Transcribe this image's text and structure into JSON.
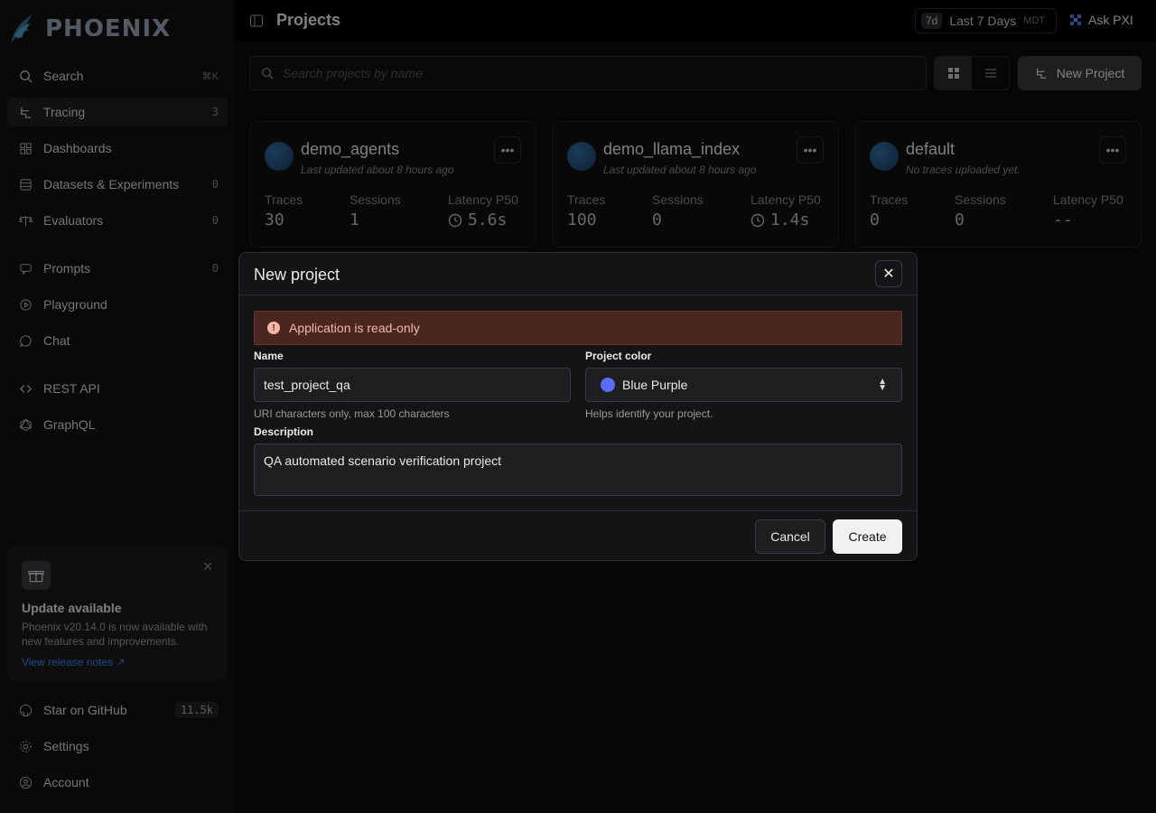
{
  "brand": {
    "name": "PHOENIX"
  },
  "sidebar": {
    "items": [
      {
        "label": "Search",
        "shortcut": "⌘K"
      },
      {
        "label": "Tracing",
        "count": "3"
      },
      {
        "label": "Dashboards"
      },
      {
        "label": "Datasets & Experiments",
        "count": "0"
      },
      {
        "label": "Evaluators",
        "count": "0"
      },
      {
        "label": "Prompts",
        "count": "0"
      },
      {
        "label": "Playground"
      },
      {
        "label": "Chat"
      },
      {
        "label": "REST API"
      },
      {
        "label": "GraphQL"
      }
    ],
    "update": {
      "title": "Update available",
      "body": "Phoenix v20.14.0 is now available with new features and improvements.",
      "link": "View release notes"
    },
    "bottom": [
      {
        "label": "Star on GitHub",
        "count": "11.5k"
      },
      {
        "label": "Settings"
      },
      {
        "label": "Account"
      }
    ]
  },
  "header": {
    "title": "Projects",
    "time_badge": "7d",
    "time_label": "Last 7 Days",
    "timezone": "MDT",
    "ask_label": "Ask PXI"
  },
  "toolbar": {
    "search_placeholder": "Search projects by name",
    "new_project_label": "New Project"
  },
  "projects": [
    {
      "name": "demo_agents",
      "subtitle": "Last updated about 8 hours ago",
      "traces": "30",
      "sessions": "1",
      "latency": "5.6s"
    },
    {
      "name": "demo_llama_index",
      "subtitle": "Last updated about 8 hours ago",
      "traces": "100",
      "sessions": "0",
      "latency": "1.4s"
    },
    {
      "name": "default",
      "subtitle": "No traces uploaded yet.",
      "traces": "0",
      "sessions": "0",
      "latency": "--"
    }
  ],
  "stat_labels": {
    "traces": "Traces",
    "sessions": "Sessions",
    "latency": "Latency P50"
  },
  "dialog": {
    "title": "New project",
    "alert": "Application is read-only",
    "name_label": "Name",
    "name_value": "test_project_qa",
    "name_help": "URI characters only, max 100 characters",
    "color_label": "Project color",
    "color_value": "Blue Purple",
    "color_swatch": "#5b6df8",
    "color_help": "Helps identify your project.",
    "description_label": "Description",
    "description_value": "QA automated scenario verification project",
    "cancel_label": "Cancel",
    "create_label": "Create"
  }
}
